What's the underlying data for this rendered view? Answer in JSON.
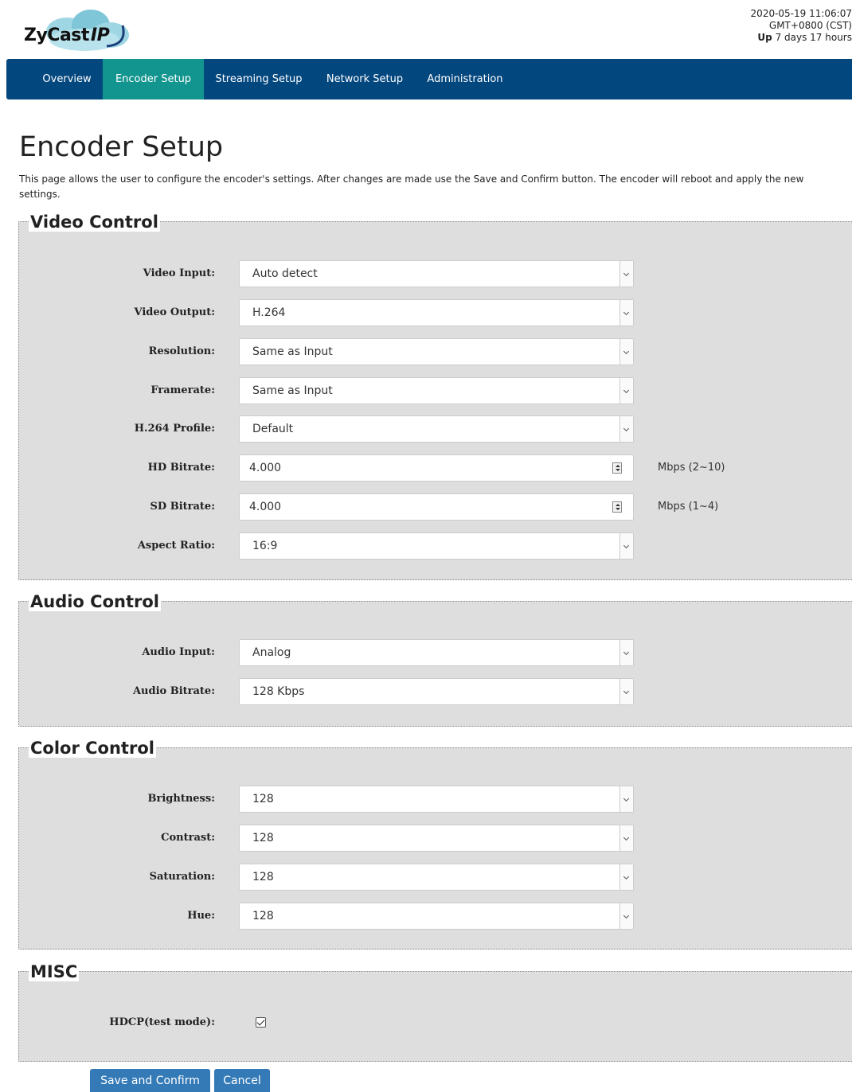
{
  "brand": {
    "logo_text": "ZyCast",
    "logo_ip": "IP"
  },
  "status": {
    "datetime": "2020-05-19 11:06:07",
    "timezone": "GMT+0800 (CST)",
    "uptime_label": "Up",
    "uptime_value": " 7 days 17 hours"
  },
  "nav": {
    "items": [
      "Overview",
      "Encoder Setup",
      "Streaming Setup",
      "Network Setup",
      "Administration"
    ],
    "active": "Encoder Setup"
  },
  "page": {
    "title": "Encoder Setup",
    "description": "This page allows the user to configure the encoder's settings. After changes are made use the Save and Confirm button. The encoder will reboot and apply the new settings."
  },
  "video": {
    "title": "Video Control",
    "video_input": {
      "label": "Video Input:",
      "value": "Auto detect"
    },
    "video_output": {
      "label": "Video Output:",
      "value": "H.264"
    },
    "resolution": {
      "label": "Resolution:",
      "value": "Same as Input"
    },
    "framerate": {
      "label": "Framerate:",
      "value": "Same as Input"
    },
    "profile": {
      "label": "H.264 Profile:",
      "value": "Default"
    },
    "hd_bitrate": {
      "label": "HD Bitrate:",
      "value": "4.000",
      "unit": "Mbps (2~10)"
    },
    "sd_bitrate": {
      "label": "SD Bitrate:",
      "value": "4.000",
      "unit": "Mbps (1~4)"
    },
    "aspect_ratio": {
      "label": "Aspect Ratio:",
      "value": "16:9"
    }
  },
  "audio": {
    "title": "Audio Control",
    "audio_input": {
      "label": "Audio Input:",
      "value": "Analog"
    },
    "audio_bitrate": {
      "label": "Audio Bitrate:",
      "value": "128 Kbps"
    }
  },
  "color": {
    "title": "Color Control",
    "brightness": {
      "label": "Brightness:",
      "value": "128"
    },
    "contrast": {
      "label": "Contrast:",
      "value": "128"
    },
    "saturation": {
      "label": "Saturation:",
      "value": "128"
    },
    "hue": {
      "label": "Hue:",
      "value": "128"
    }
  },
  "misc": {
    "title": "MISC",
    "hdcp": {
      "label": "HDCP(test mode):",
      "checked": true
    }
  },
  "buttons": {
    "save": "Save and Confirm",
    "cancel": "Cancel"
  },
  "colors": {
    "nav_bg": "#03477f",
    "nav_active": "#12958f",
    "panel_bg": "#dedede",
    "button": "#337ab7",
    "logo_cloud": "#7fc6d8"
  }
}
